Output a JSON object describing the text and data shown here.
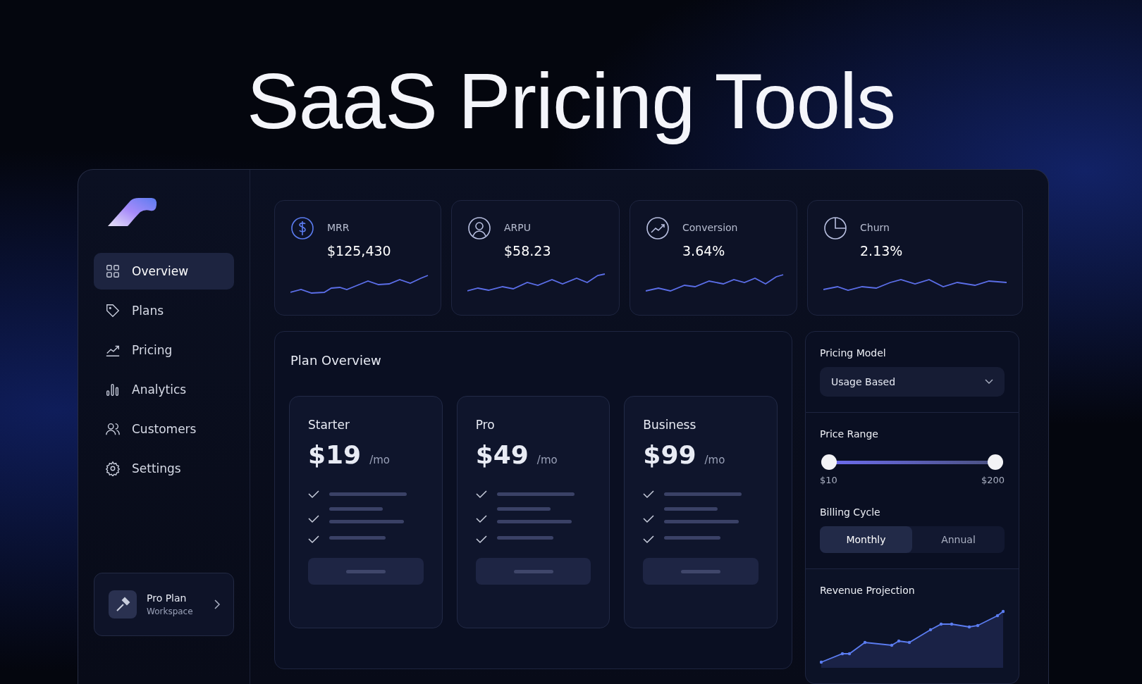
{
  "headline": "SaaS Pricing Tools",
  "sidebar": {
    "items": [
      {
        "label": "Overview",
        "kind": "grid",
        "selected": true
      },
      {
        "label": "Plans",
        "kind": "tag",
        "selected": false
      },
      {
        "label": "Pricing",
        "kind": "trend",
        "selected": false
      },
      {
        "label": "Analytics",
        "kind": "bars",
        "selected": false
      },
      {
        "label": "Customers",
        "kind": "users",
        "selected": false
      },
      {
        "label": "Settings",
        "kind": "gear",
        "selected": false
      }
    ],
    "account": {
      "name": "Pro Plan",
      "subtitle": "Workspace"
    }
  },
  "stats": [
    {
      "label": "MRR",
      "value": "$125,430",
      "kind": "dollar"
    },
    {
      "label": "ARPU",
      "value": "$58.23",
      "kind": "user"
    },
    {
      "label": "Conversion",
      "value": "3.64%",
      "kind": "trend"
    },
    {
      "label": "Churn",
      "value": "2.13%",
      "kind": "clock"
    }
  ],
  "plan_overview": {
    "title": "Plan Overview",
    "plans": [
      {
        "name": "Starter",
        "price": "$19",
        "period": "/mo"
      },
      {
        "name": "Pro",
        "price": "$49",
        "period": "/mo"
      },
      {
        "name": "Business",
        "price": "$99",
        "period": "/mo"
      }
    ]
  },
  "controls": {
    "pricing_model": {
      "label": "Pricing Model",
      "value": "Usage Based"
    },
    "price_range": {
      "label": "Price Range",
      "min": "$10",
      "max": "$200",
      "level": 1
    },
    "billing_cycle": {
      "label": "Billing Cycle",
      "options": [
        {
          "label": "Monthly",
          "selected": true
        },
        {
          "label": "Annual",
          "selected": false
        }
      ]
    },
    "revenue_projection": {
      "title": "Revenue Projection"
    }
  }
}
